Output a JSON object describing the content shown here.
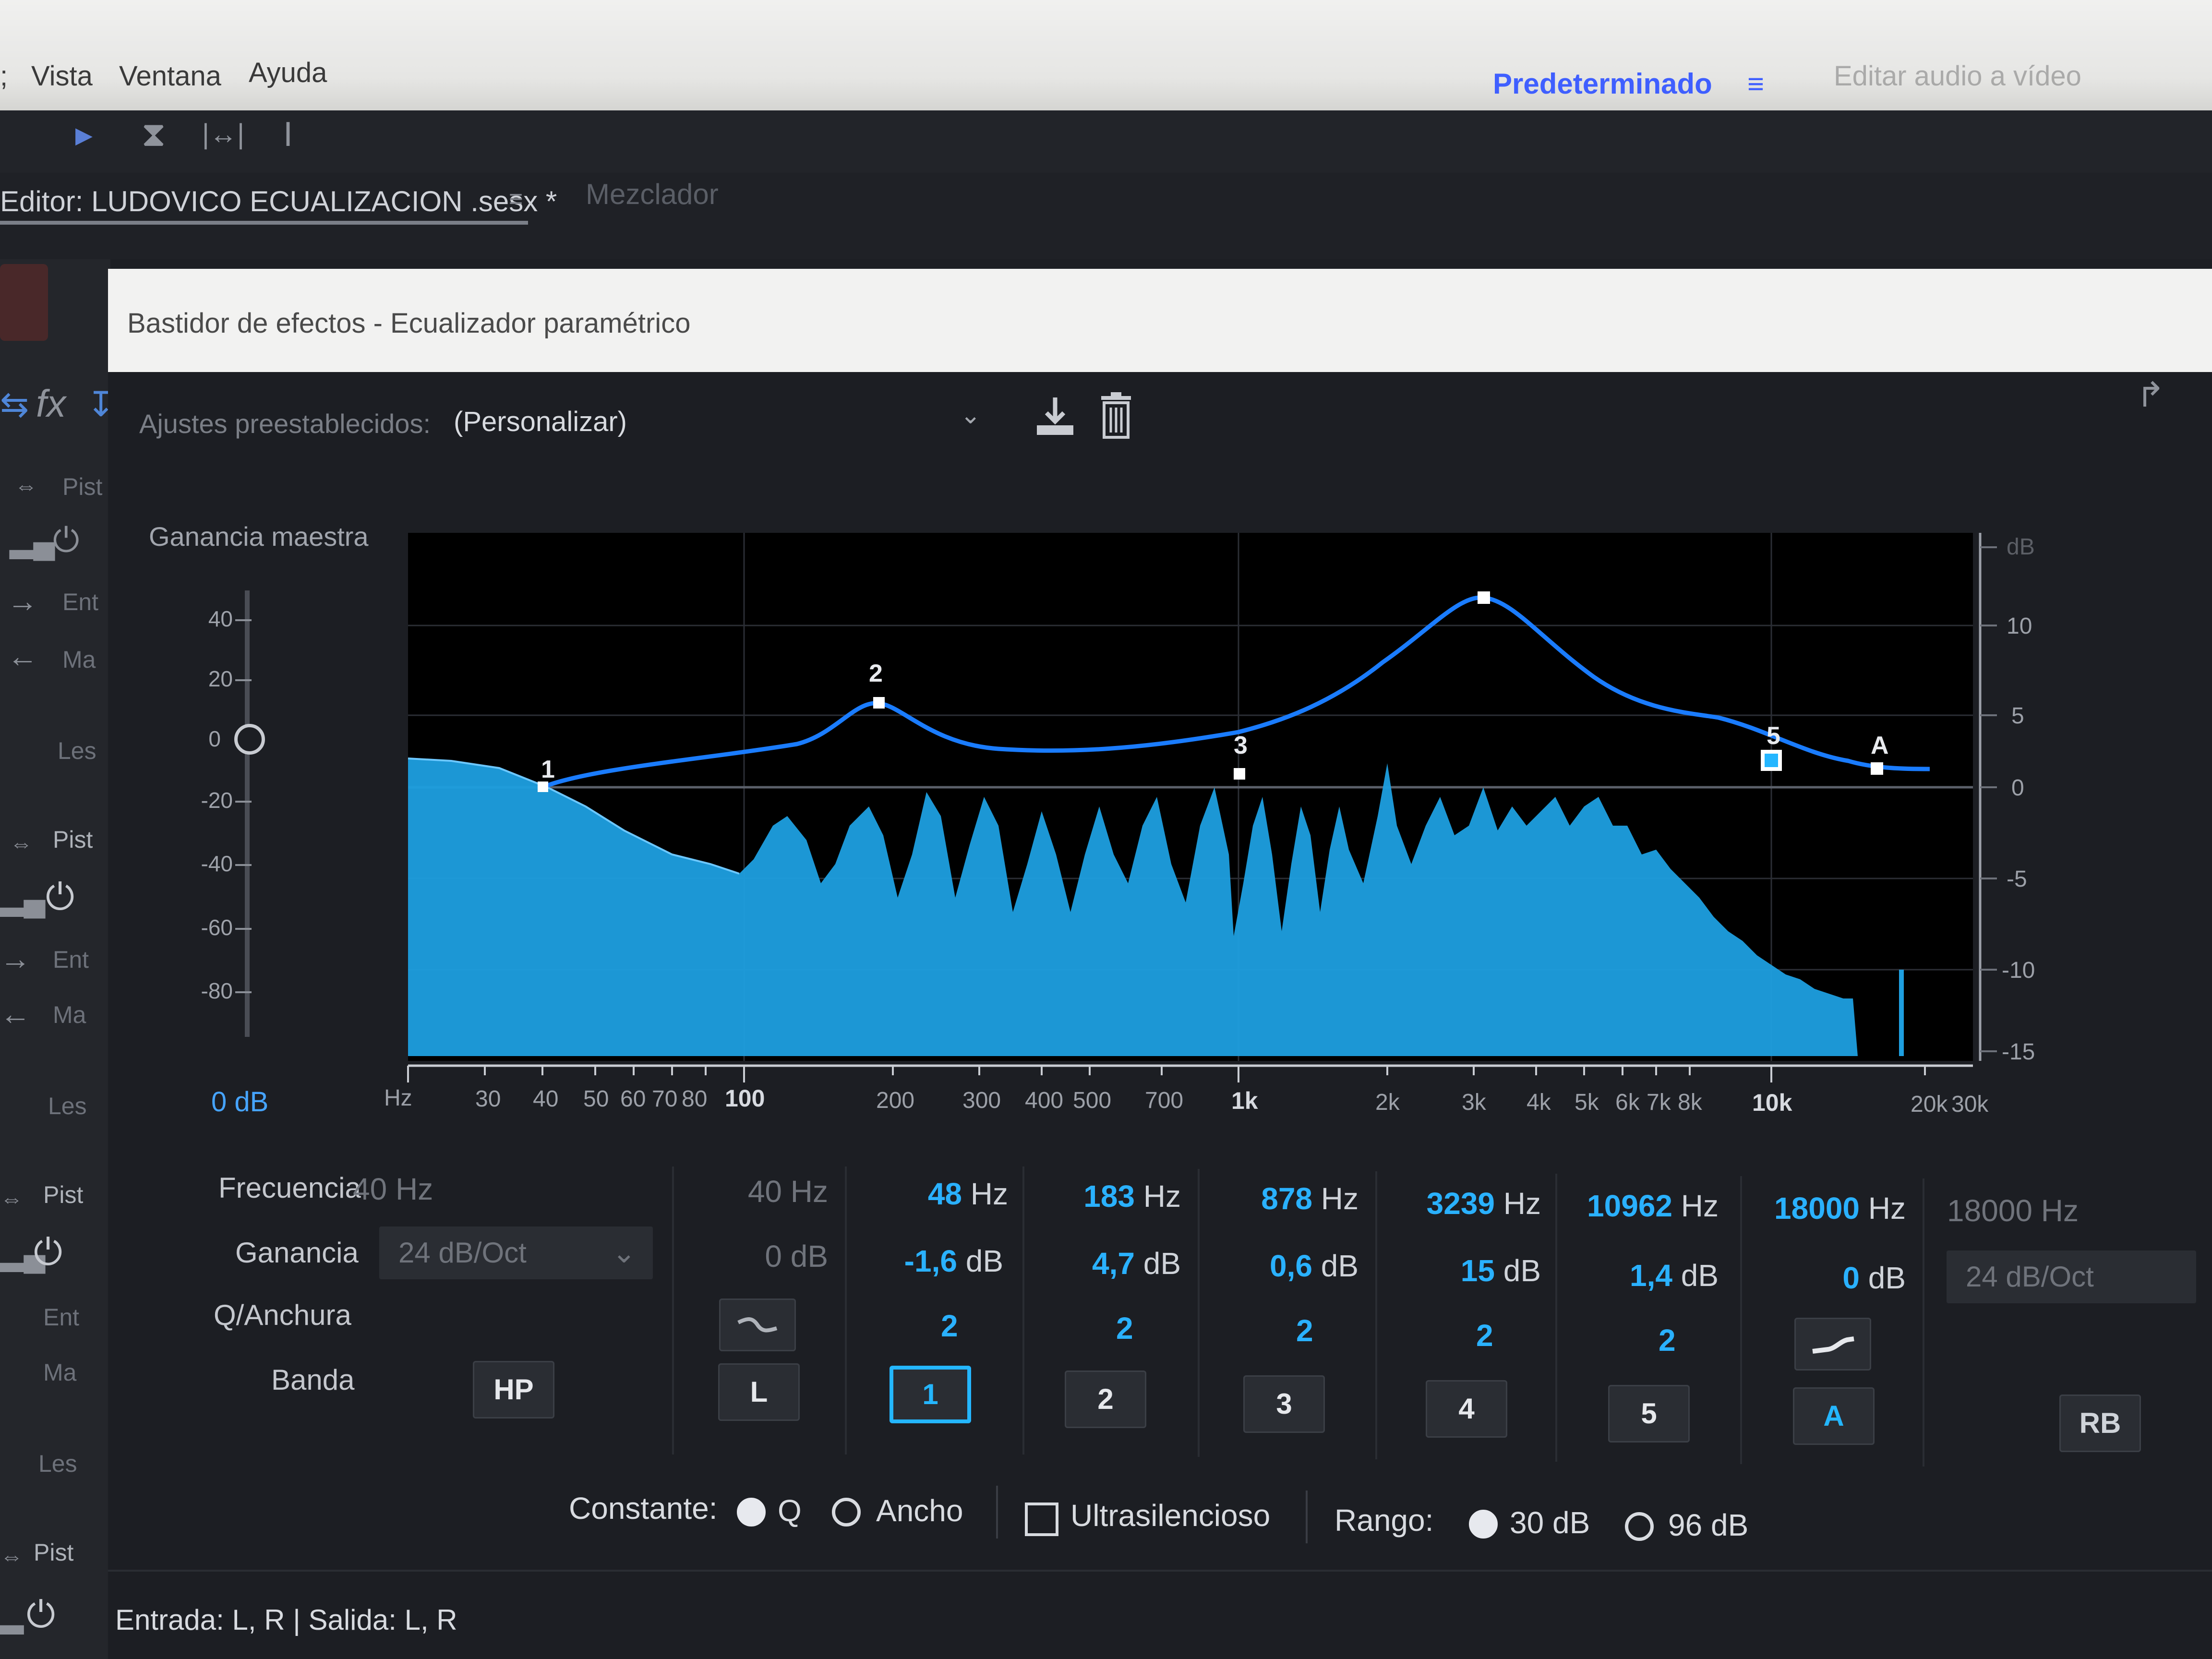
{
  "menu": {
    "items": [
      "Vista",
      "Ventana",
      "Ayuda"
    ],
    "leading": ";"
  },
  "workspace": {
    "name": "Predeterminado",
    "menu": "≡",
    "edit": "Editar audio a vídeo"
  },
  "editor": {
    "tab": "Editor: LUDOVICO ECUALIZACION .sesx *",
    "menu_icon": "≡",
    "mixer_tab": "Mezclador"
  },
  "window": {
    "title": "Bastidor de efectos - Ecualizador paramétrico"
  },
  "presets": {
    "label": "Ajustes preestablecidos:",
    "value": "(Personalizar)"
  },
  "left_strip": {
    "track_label": "Pist",
    "items": [
      "Ent",
      "Ma",
      "Les"
    ]
  },
  "master_gain": {
    "label": "Ganancia maestra",
    "scale": [
      "40",
      "20",
      "0",
      "-20",
      "-40",
      "-60",
      "-80"
    ],
    "value": "0 dB"
  },
  "graph": {
    "freq_unit": "Hz",
    "freq_ticks": [
      "30",
      "40",
      "50",
      "60",
      "70",
      "80",
      "100",
      "200",
      "300",
      "400",
      "500",
      "700",
      "1k",
      "2k",
      "3k",
      "4k",
      "5k",
      "6k",
      "7k",
      "8k",
      "10k",
      "20k",
      "30k"
    ],
    "db_unit": "dB",
    "db_ticks": [
      "10",
      "5",
      "0",
      "-5",
      "-10",
      "-15"
    ],
    "node_labels": [
      "1",
      "2",
      "3",
      "5",
      "A"
    ]
  },
  "controls": {
    "labels": {
      "frequency": "Frecuencia",
      "gain": "Ganancia",
      "q": "Q/Anchura",
      "band": "Banda"
    },
    "hp": {
      "freq": "40 Hz",
      "slope": "24 dB/Oct",
      "button": "HP"
    },
    "low_shelf": {
      "freq": "40 Hz",
      "gain": "0 dB",
      "button": "L"
    },
    "bands": [
      {
        "freq_num": "48",
        "gain_num": "-1,6",
        "q": "2",
        "button": "1"
      },
      {
        "freq_num": "183",
        "gain_num": "4,7",
        "q": "2",
        "button": "2"
      },
      {
        "freq_num": "878",
        "gain_num": "0,6",
        "q": "2",
        "button": "3"
      },
      {
        "freq_num": "3239",
        "gain_num": "15",
        "q": "2",
        "button": "4"
      },
      {
        "freq_num": "10962",
        "gain_num": "1,4",
        "q": "2",
        "button": "5"
      }
    ],
    "high_shelf": {
      "freq_num": "18000",
      "gain_num": "0",
      "button": "A"
    },
    "lp": {
      "freq": "18000 Hz",
      "slope": "24 dB/Oct",
      "button": "RB"
    },
    "freq_unit": "Hz",
    "gain_unit": "dB"
  },
  "options": {
    "constant_label": "Constante:",
    "q_label": "Q",
    "width_label": "Ancho",
    "ultra_label": "Ultrasilencioso",
    "range_label": "Rango:",
    "range_30": "30 dB",
    "range_96": "96 dB",
    "constant_selected": "Q",
    "range_selected": "30 dB",
    "ultra_checked": false
  },
  "io": {
    "text": "Entrada: L, R | Salida: L, R"
  },
  "colors": {
    "accent": "#24b6ff",
    "curve": "#1a7cff",
    "spectrum": "#1e9fe0"
  }
}
